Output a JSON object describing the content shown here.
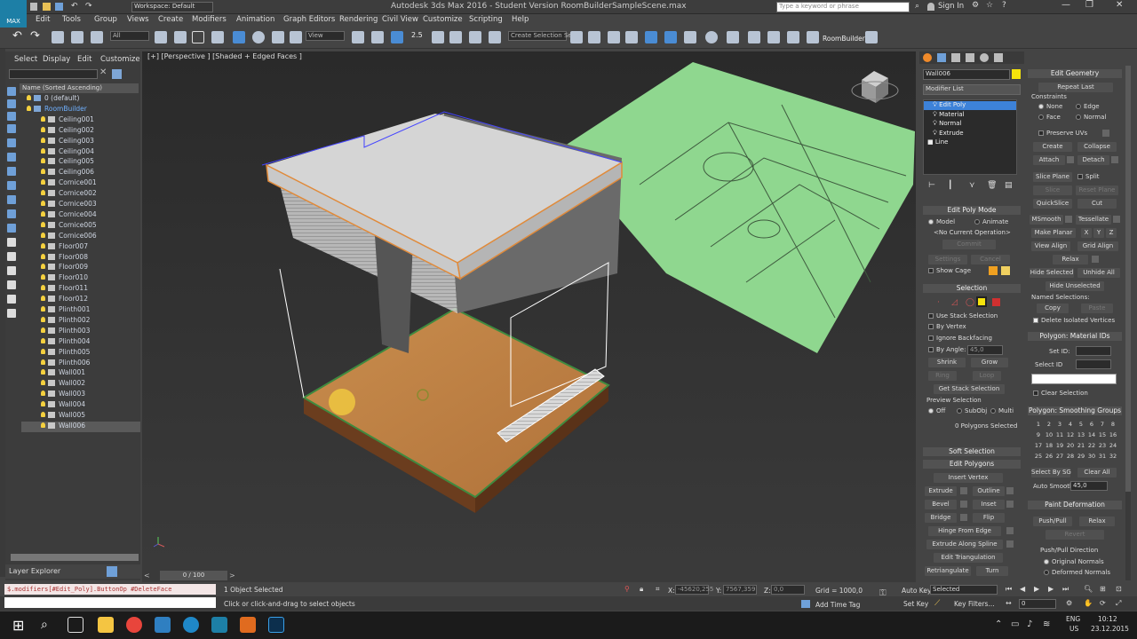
{
  "window": {
    "title": "Autodesk 3ds Max 2016 - Student Version    RoomBuilderSampleScene.max",
    "workspace": "Workspace: Default",
    "search_placeholder": "Type a keyword or phrase",
    "sign_in": "Sign In",
    "logo": "MAX"
  },
  "menu": [
    "Edit",
    "Tools",
    "Group",
    "Views",
    "Create",
    "Modifiers",
    "Animation",
    "Graph Editors",
    "Rendering",
    "Civil View",
    "Customize",
    "Scripting",
    "Help"
  ],
  "toolbar": {
    "filter": "All",
    "view": "View",
    "selection_set": "Create Selection Se",
    "roombuilder": "RoomBuilder",
    "snap_label": "2.5"
  },
  "scene_explorer": {
    "tabs": [
      "Select",
      "Display",
      "Edit",
      "Customize"
    ],
    "column_header": "Name (Sorted Ascending)",
    "rows": [
      "0 (default)",
      "RoomBuilder",
      "Ceiling001",
      "Ceiling002",
      "Ceiling003",
      "Ceiling004",
      "Ceiling005",
      "Ceiling006",
      "Cornice001",
      "Cornice002",
      "Cornice003",
      "Cornice004",
      "Cornice005",
      "Cornice006",
      "Floor007",
      "Floor008",
      "Floor009",
      "Floor010",
      "Floor011",
      "Floor012",
      "Plinth001",
      "Plinth002",
      "Plinth003",
      "Plinth004",
      "Plinth005",
      "Plinth006",
      "Wall001",
      "Wall002",
      "Wall003",
      "Wall004",
      "Wall005",
      "Wall006"
    ],
    "footer": "Layer Explorer"
  },
  "viewport": {
    "label": "[+] [Perspective ] [Shaded + Edged Faces ]"
  },
  "timeline": {
    "frame": "0 / 100"
  },
  "status": {
    "maxscript": "$.modifiers[#Edit_Poly].ButtonOp #DeleteFace",
    "selected": "1 Object Selected",
    "prompt": "Click or click-and-drag to select objects",
    "x_label": "X:",
    "x": "-45620,255",
    "y_label": "Y:",
    "y": "7567,359",
    "z_label": "Z:",
    "z": "0,0",
    "grid": "Grid = 1000,0",
    "add_time_tag": "Add Time Tag",
    "auto_key": "Auto Key",
    "auto_key_mode": "Selected",
    "set_key": "Set Key",
    "key_filters": "Key Filters...",
    "frame_field": "0"
  },
  "taskbar": {
    "lang": "ENG",
    "locale": "US",
    "time": "10:12",
    "date": "23.12.2015"
  },
  "command_panel": {
    "object_name": "Wall006",
    "modifier_list": "Modifier List",
    "stack": [
      "Edit Poly",
      "Material",
      "Normal",
      "Extrude",
      "Line"
    ],
    "edit_poly_mode": {
      "header": "Edit Poly Mode",
      "model": "Model",
      "animate": "Animate",
      "current_op": "<No Current Operation>",
      "commit": "Commit",
      "settings": "Settings",
      "cancel": "Cancel",
      "show_cage": "Show Cage"
    },
    "selection": {
      "header": "Selection",
      "use_stack": "Use Stack Selection",
      "by_vertex": "By Vertex",
      "ignore_backfacing": "Ignore Backfacing",
      "by_angle": "By Angle:",
      "by_angle_val": "45,0",
      "shrink": "Shrink",
      "grow": "Grow",
      "ring": "Ring",
      "loop": "Loop",
      "get_stack": "Get Stack Selection",
      "preview": "Preview Selection",
      "off": "Off",
      "subobj": "SubObj",
      "multi": "Multi",
      "status": "0 Polygons Selected"
    },
    "soft_selection": "Soft Selection",
    "edit_polygons": {
      "header": "Edit Polygons",
      "insert_vertex": "Insert Vertex",
      "extrude": "Extrude",
      "outline": "Outline",
      "bevel": "Bevel",
      "inset": "Inset",
      "bridge": "Bridge",
      "flip": "Flip",
      "hinge": "Hinge From Edge",
      "extrude_spline": "Extrude Along Spline",
      "edit_tri": "Edit Triangulation",
      "retriangulate": "Retriangulate",
      "turn": "Turn"
    }
  },
  "edit_geometry": {
    "header": "Edit Geometry",
    "repeat_last": "Repeat Last",
    "constraints": "Constraints",
    "none": "None",
    "edge": "Edge",
    "face": "Face",
    "normal": "Normal",
    "preserve_uvs": "Preserve UVs",
    "create": "Create",
    "collapse": "Collapse",
    "attach": "Attach",
    "detach": "Detach",
    "slice_plane": "Slice Plane",
    "split": "Split",
    "slice": "Slice",
    "reset_plane": "Reset Plane",
    "quickslice": "QuickSlice",
    "cut": "Cut",
    "msmooth": "MSmooth",
    "tessellate": "Tessellate",
    "make_planar": "Make Planar",
    "x": "X",
    "y": "Y",
    "z": "Z",
    "view_align": "View Align",
    "grid_align": "Grid Align",
    "relax": "Relax",
    "hide_selected": "Hide Selected",
    "unhide_all": "Unhide All",
    "hide_unselected": "Hide Unselected",
    "named_selections": "Named Selections:",
    "copy": "Copy",
    "paste": "Paste",
    "delete_isolated": "Delete Isolated Vertices",
    "material_ids_header": "Polygon: Material IDs",
    "set_id": "Set ID:",
    "select_id": "Select ID",
    "clear_selection": "Clear Selection",
    "smoothing_header": "Polygon: Smoothing Groups",
    "groups": [
      "1",
      "2",
      "3",
      "4",
      "5",
      "6",
      "7",
      "8",
      "9",
      "10",
      "11",
      "12",
      "13",
      "14",
      "15",
      "16",
      "17",
      "18",
      "19",
      "20",
      "21",
      "22",
      "23",
      "24",
      "25",
      "26",
      "27",
      "28",
      "29",
      "30",
      "31",
      "32"
    ],
    "select_by_sg": "Select By SG",
    "clear_all": "Clear All",
    "auto_smooth": "Auto Smooth",
    "auto_smooth_val": "45,0",
    "paint_header": "Paint Deformation",
    "push_pull": "Push/Pull",
    "relax2": "Relax",
    "revert": "Revert",
    "pp_direction": "Push/Pull Direction",
    "original_normals": "Original Normals",
    "deformed_normals": "Deformed Normals"
  }
}
